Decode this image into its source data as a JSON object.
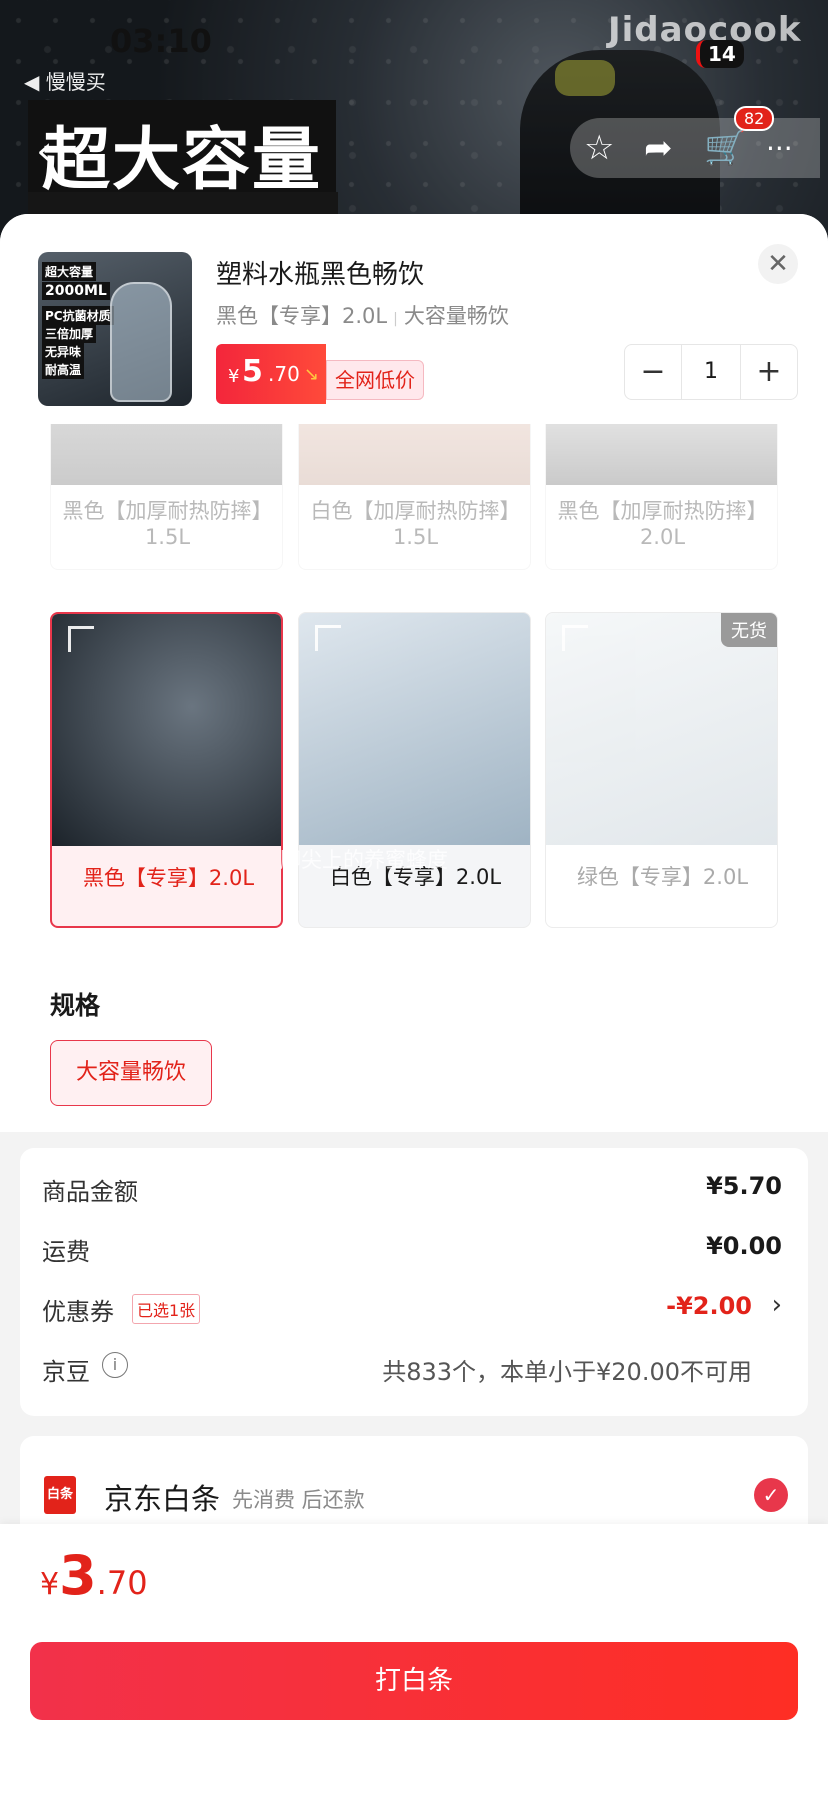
{
  "status": {
    "time": "03:10",
    "back_label": "◀ 慢慢买",
    "battery": "14",
    "brand": "Jidaocook"
  },
  "hero": {
    "banner": "超大容量",
    "cart_count": "82"
  },
  "product": {
    "title": "塑料水瓶黑色畅饮",
    "selected_color": "黑色【专享】2.0L",
    "selected_spec": "大容量畅饮",
    "price_big": "5",
    "price_small": ".70",
    "price_yen": "¥",
    "low_price_badge": "全网低价",
    "quantity": "1",
    "thumb_tags": [
      "超大容量",
      "2000ML",
      "PC抗菌材质",
      "三倍加厚",
      "无异味",
      "耐高温"
    ]
  },
  "colors": {
    "options": [
      {
        "label": "黑色【加厚耐热防摔】1.5L",
        "state": "faded"
      },
      {
        "label": "白色【加厚耐热防摔】1.5L",
        "state": "faded"
      },
      {
        "label": "黑色【加厚耐热防摔】2.0L",
        "state": "faded"
      },
      {
        "label": "黑色【专享】2.0L",
        "state": "selected"
      },
      {
        "label": "白色【专享】2.0L",
        "state": "normal"
      },
      {
        "label": "绿色【专享】2.0L",
        "state": "out_of_stock"
      }
    ],
    "oos_badge": "无货",
    "overlay_text": "脚尖上的养蜜蜂度"
  },
  "spec": {
    "title": "规格",
    "options": [
      "大容量畅饮"
    ]
  },
  "summary": {
    "goods_label": "商品金额",
    "goods_value": "¥5.70",
    "shipping_label": "运费",
    "shipping_value": "¥0.00",
    "coupon_label": "优惠券",
    "coupon_tag": "已选1张",
    "coupon_value": "-¥2.00",
    "beans_label": "京豆",
    "beans_value": "共833个，本单小于¥20.00不可用"
  },
  "payment": {
    "name": "京东白条",
    "desc": "先消费 后还款",
    "logo_text": "白条"
  },
  "bottom": {
    "total_yen": "¥",
    "total_big": "3",
    "total_small": ".70",
    "cta": "打白条"
  },
  "colors_theme": {
    "accent": "#e2231a",
    "accent_light": "#fff0f2"
  }
}
